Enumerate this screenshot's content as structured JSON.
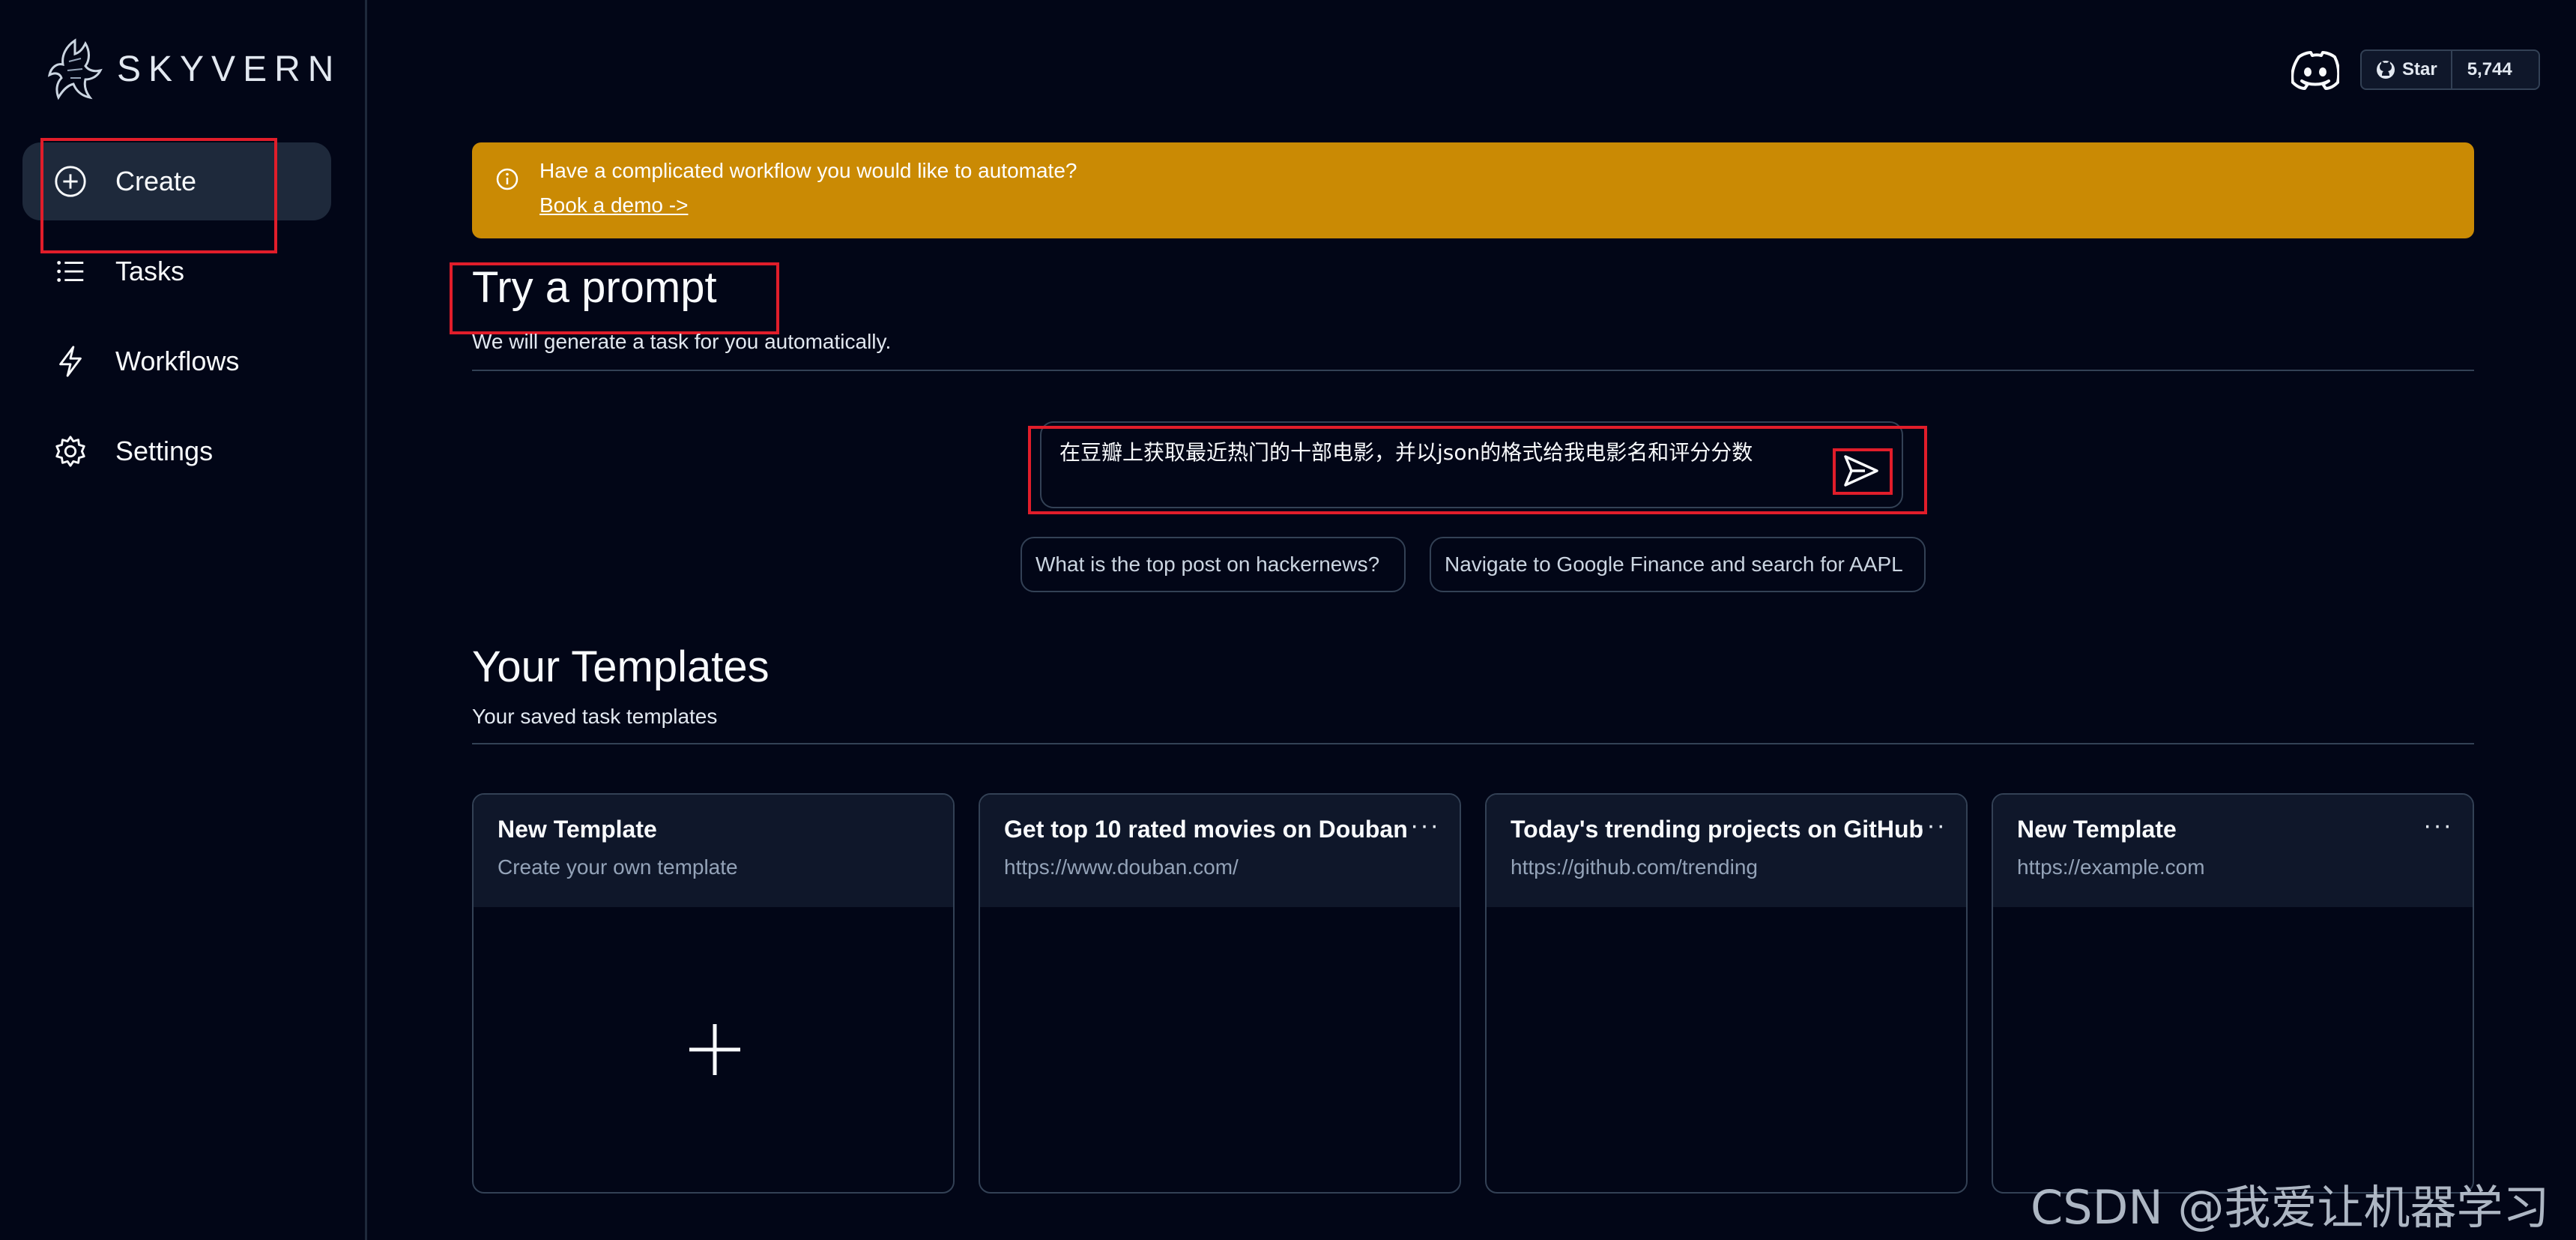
{
  "brand": {
    "name": "SKYVERN"
  },
  "sidebar": {
    "items": [
      {
        "label": "Create",
        "icon": "plus-circle-icon",
        "active": true
      },
      {
        "label": "Tasks",
        "icon": "list-icon"
      },
      {
        "label": "Workflows",
        "icon": "lightning-icon"
      },
      {
        "label": "Settings",
        "icon": "gear-icon"
      }
    ]
  },
  "topbar": {
    "github_star_label": "Star",
    "github_star_count": "5,744"
  },
  "banner": {
    "message": "Have a complicated workflow you would like to automate?",
    "link": "Book a demo ->",
    "color": "#ca8a04"
  },
  "prompt_section": {
    "title": "Try a prompt",
    "subtitle": "We will generate a task for you automatically.",
    "input_value": "在豆瓣上获取最近热门的十部电影，并以json的格式给我电影名和评分分数",
    "suggestions": [
      "What is the top post on hackernews?",
      "Navigate to Google Finance and search for AAPL"
    ]
  },
  "templates_section": {
    "title": "Your Templates",
    "subtitle": "Your saved task templates",
    "cards": [
      {
        "title": "New Template",
        "subtitle": "Create your own template"
      },
      {
        "title": "Get top 10 rated movies on Douban",
        "subtitle": "https://www.douban.com/",
        "menu": "···"
      },
      {
        "title": "Today's trending projects on GitHub",
        "subtitle": "https://github.com/trending",
        "menu": "···"
      },
      {
        "title": "New Template",
        "subtitle": "https://example.com",
        "menu": "···"
      }
    ]
  },
  "watermark": "CSDN @我爱让机器学习",
  "annotation_color": "#e11d2a"
}
